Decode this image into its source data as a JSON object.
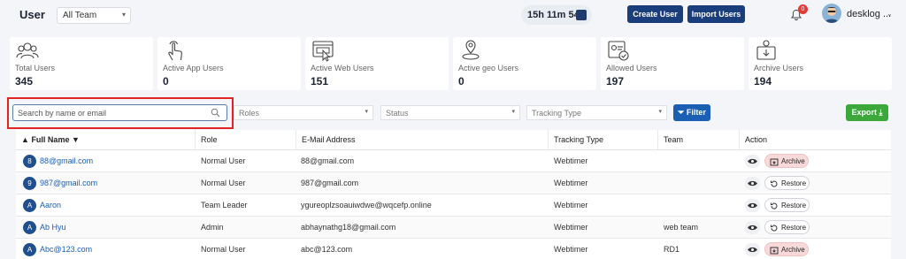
{
  "header": {
    "title": "User",
    "team_select": "All Team",
    "timer": "15h 11m 54s",
    "create_user": "Create User",
    "import_users": "Import Users",
    "notification_count": "0",
    "username": "desklog ..."
  },
  "stats": [
    {
      "label": "Total Users",
      "value": "345",
      "icon": "users-icon"
    },
    {
      "label": "Active App Users",
      "value": "0",
      "icon": "touch-icon"
    },
    {
      "label": "Active Web Users",
      "value": "151",
      "icon": "web-click-icon"
    },
    {
      "label": "Active geo Users",
      "value": "0",
      "icon": "geo-user-icon"
    },
    {
      "label": "Allowed Users",
      "value": "197",
      "icon": "id-check-icon"
    },
    {
      "label": "Archive Users",
      "value": "194",
      "icon": "archive-user-icon"
    }
  ],
  "filters": {
    "search_placeholder": "Search by name or email",
    "roles": "Roles",
    "status": "Status",
    "tracking_type": "Tracking Type",
    "filter": "Filter",
    "export": "Export"
  },
  "table": {
    "columns": [
      "Full Name",
      "Role",
      "E-Mail Address",
      "Tracking Type",
      "Team",
      "Action"
    ],
    "rows": [
      {
        "initial": "8",
        "name": "88@gmail.com",
        "role": "Normal User",
        "email": "88@gmail.com",
        "tracking": "Webtimer",
        "team": "",
        "action": "Archive"
      },
      {
        "initial": "9",
        "name": "987@gmail.com",
        "role": "Normal User",
        "email": "987@gmail.com",
        "tracking": "Webtimer",
        "team": "",
        "action": "Restore"
      },
      {
        "initial": "A",
        "name": "Aaron",
        "role": "Team Leader",
        "email": "ygureoplzsoauiwdwe@wqcefp.online",
        "tracking": "Webtimer",
        "team": "",
        "action": "Restore"
      },
      {
        "initial": "A",
        "name": "Ab Hyu",
        "role": "Admin",
        "email": "abhaynathg18@gmail.com",
        "tracking": "Webtimer",
        "team": "web team",
        "action": "Restore"
      },
      {
        "initial": "A",
        "name": "Abc@123.com",
        "role": "Normal User",
        "email": "abc@123.com",
        "tracking": "Webtimer",
        "team": "RD1",
        "action": "Archive"
      }
    ]
  },
  "colors": {
    "primary": "#1a3d7c",
    "filter": "#1a5fb4",
    "export": "#3ca83c",
    "highlight": "#e02424"
  }
}
